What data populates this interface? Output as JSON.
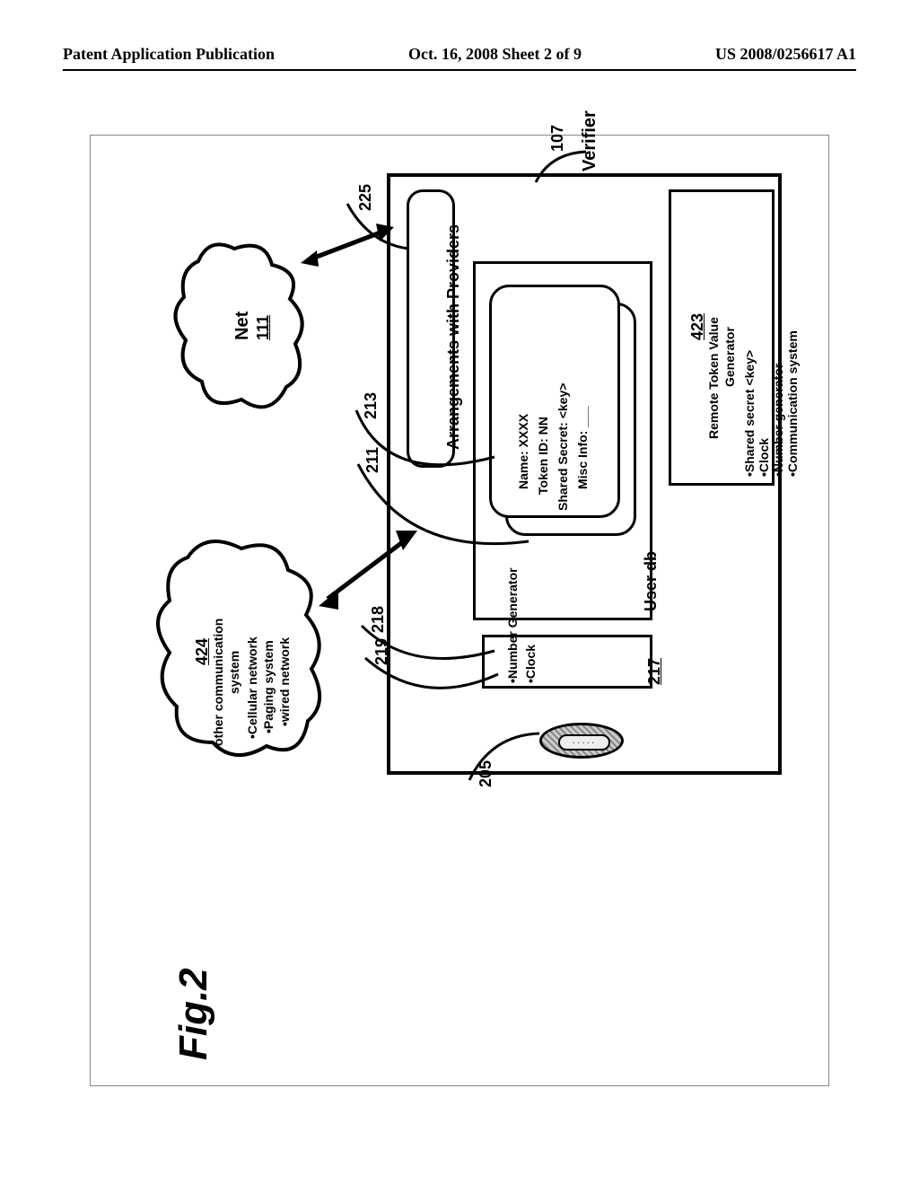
{
  "header": {
    "left": "Patent Application Publication",
    "center": "Oct. 16, 2008  Sheet 2 of 9",
    "right": "US 2008/0256617 A1"
  },
  "figure_label": "Fig.2",
  "verifier": {
    "title": "Verifier",
    "lead_ref": "107",
    "arrangements": "Arrangements with Providers",
    "arrangements_ref": "225",
    "user_db": {
      "label": "User db",
      "card": {
        "name": "Name: XXXX",
        "token": "Token ID: NN",
        "secret": "Shared Secret: <key>",
        "misc": "Misc Info: ___"
      },
      "card_front_ref": "213",
      "card_back_ref": "211"
    },
    "numgen_box": {
      "numgen": "•Number Generator",
      "clock": "•Clock",
      "ref": "217",
      "numgen_lead": "218",
      "clock_lead": "219"
    },
    "remote_token": {
      "ref": "423",
      "title": "Remote Token Value Generator",
      "items": [
        "•Shared secret <key>",
        "•Clock",
        "•Number generator",
        "•Communication system"
      ]
    },
    "button_ref": "205"
  },
  "net_cloud": {
    "label": "Net",
    "ref": "111"
  },
  "comm_cloud": {
    "ref": "424",
    "title": "other communication system",
    "items": [
      "•Cellular network",
      "•Paging system",
      "•wired network"
    ]
  }
}
